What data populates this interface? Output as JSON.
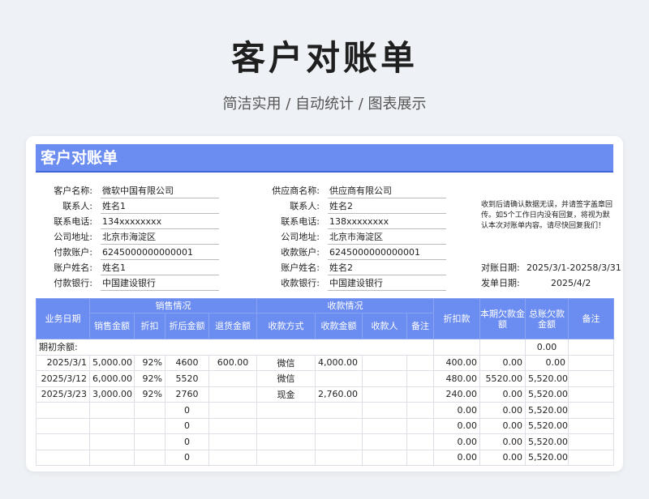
{
  "header": {
    "title": "客户对账单",
    "subtitle": "简洁实用 / 自动统计 / 图表展示"
  },
  "sheet": {
    "title": "客户对账单",
    "customer": {
      "name_label": "客户名称:",
      "name": "微软中国有限公司",
      "contact_label": "联系人:",
      "contact": "姓名1",
      "phone_label": "联系电话:",
      "phone": "134xxxxxxxx",
      "address_label": "公司地址:",
      "address": "北京市海淀区",
      "account_label": "付款账户:",
      "account": "6245000000000001",
      "account_name_label": "账户姓名:",
      "account_name": "姓名1",
      "bank_label": "付款银行:",
      "bank": "中国建设银行"
    },
    "supplier": {
      "name_label": "供应商名称:",
      "name": "供应商有限公司",
      "contact_label": "联系人:",
      "contact": "姓名2",
      "phone_label": "联系电话:",
      "phone": "138xxxxxxxx",
      "address_label": "公司地址:",
      "address": "北京市海淀区",
      "account_label": "收款账户:",
      "account": "6245000000000001",
      "account_name_label": "账户姓名:",
      "account_name": "姓名2",
      "bank_label": "收款银行:",
      "bank": "中国建设银行"
    },
    "note": "收到后请确认数据无误，并请签字盖章回传。如5个工作日内没有回复，将视为默认本次对账单内容。请尽快回复我们！",
    "period_label": "对账日期:",
    "period": "2025/3/1-20258/3/31",
    "issue_label": "发单日期:",
    "issue": "2025/4/2"
  },
  "table": {
    "headers": {
      "date": "业务日期",
      "sales_group": "销售情况",
      "sales_amount": "销售金额",
      "discount": "折扣",
      "discounted": "折后金额",
      "returns": "退货金额",
      "payment_group": "收款情况",
      "method": "收款方式",
      "received": "收款金额",
      "payee": "收款人",
      "pay_note": "备注",
      "rebate": "折扣款",
      "current_owed": "本期欠款金额",
      "total_owed": "总账欠款金额",
      "remark": "备注"
    },
    "opening_label": "期初余额:",
    "opening_total": "0.00",
    "rows": [
      [
        "2025/3/1",
        "5,000.00",
        "92%",
        "4600",
        "600.00",
        "微信",
        "4,000.00",
        "",
        "",
        "400.00",
        "0.00",
        "0.00",
        ""
      ],
      [
        "2025/3/12",
        "6,000.00",
        "92%",
        "5520",
        "",
        "微信",
        "",
        "",
        "",
        "480.00",
        "5520.00",
        "5,520.00",
        ""
      ],
      [
        "2025/3/23",
        "3,000.00",
        "92%",
        "2760",
        "",
        "现金",
        "2,760.00",
        "",
        "",
        "240.00",
        "0.00",
        "5,520.00",
        ""
      ],
      [
        "",
        "",
        "",
        "0",
        "",
        "",
        "",
        "",
        "",
        "0.00",
        "0.00",
        "5,520.00",
        ""
      ],
      [
        "",
        "",
        "",
        "0",
        "",
        "",
        "",
        "",
        "",
        "0.00",
        "0.00",
        "5,520.00",
        ""
      ],
      [
        "",
        "",
        "",
        "0",
        "",
        "",
        "",
        "",
        "",
        "0.00",
        "0.00",
        "5,520.00",
        ""
      ],
      [
        "",
        "",
        "",
        "0",
        "",
        "",
        "",
        "",
        "",
        "0.00",
        "0.00",
        "5,520.00",
        ""
      ]
    ]
  }
}
